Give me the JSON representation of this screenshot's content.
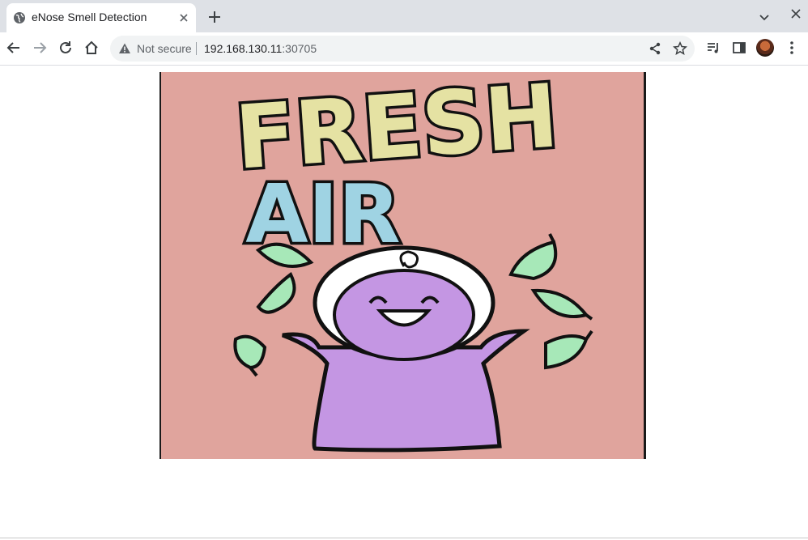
{
  "browser": {
    "tab": {
      "title": "eNose Smell Detection"
    },
    "address_bar": {
      "security_label": "Not secure",
      "url_host": "192.168.130.11",
      "url_port": ":30705"
    }
  },
  "poster": {
    "headline_line1": "FRESH",
    "headline_line2": "AIR",
    "colors": {
      "background": "#e0a49d",
      "fresh_text": "#e5e2a3",
      "air_text": "#9fd3e3",
      "character": "#c496e3",
      "hood": "#ffffff",
      "leaf": "#a7e8b8",
      "outline": "#111111"
    }
  }
}
